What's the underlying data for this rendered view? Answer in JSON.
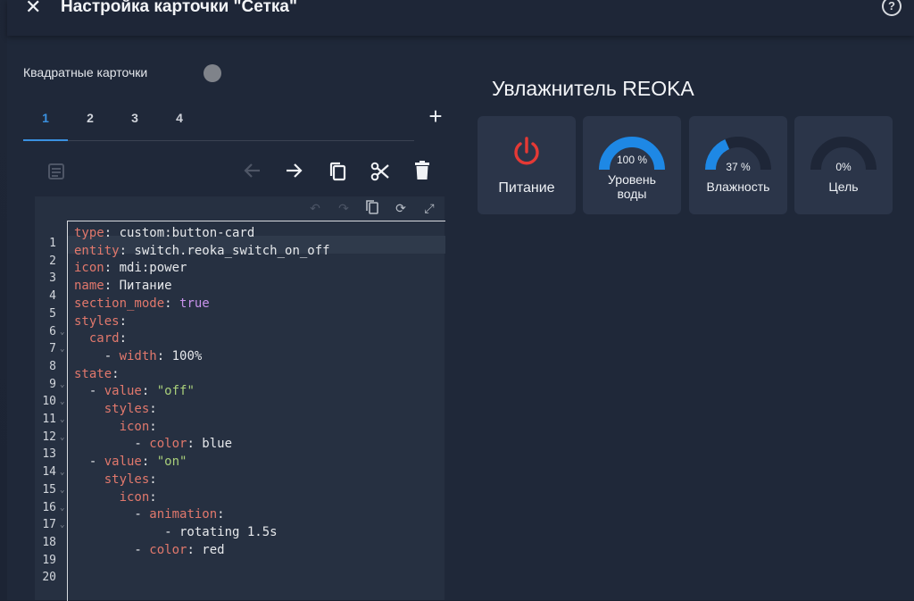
{
  "dialog": {
    "title": "Настройка карточки \"Сетка\"",
    "close_icon": "close-icon",
    "help_icon": "help-circle-icon",
    "help_glyph": "?"
  },
  "editor_options": {
    "square_cards_label": "Квадратные карточки",
    "square_cards_on": false
  },
  "tabs": [
    {
      "label": "1",
      "active": true
    },
    {
      "label": "2",
      "active": false
    },
    {
      "label": "3",
      "active": false
    },
    {
      "label": "4",
      "active": false
    }
  ],
  "toolbar": {
    "icons": [
      "list-editor-icon",
      "arrow-left-icon",
      "arrow-right-icon",
      "copy-icon",
      "cut-icon",
      "delete-icon"
    ]
  },
  "code_editor": {
    "toolbar_icons": [
      "undo-icon",
      "redo-icon",
      "copy-icon",
      "refresh-icon",
      "fullscreen-icon"
    ],
    "lines": [
      {
        "n": "1",
        "fold": false
      },
      {
        "n": "2",
        "fold": false
      },
      {
        "n": "3",
        "fold": false
      },
      {
        "n": "4",
        "fold": false
      },
      {
        "n": "5",
        "fold": false
      },
      {
        "n": "6",
        "fold": true
      },
      {
        "n": "7",
        "fold": true
      },
      {
        "n": "8",
        "fold": false
      },
      {
        "n": "9",
        "fold": true
      },
      {
        "n": "10",
        "fold": true
      },
      {
        "n": "11",
        "fold": true
      },
      {
        "n": "12",
        "fold": true
      },
      {
        "n": "13",
        "fold": false
      },
      {
        "n": "14",
        "fold": true
      },
      {
        "n": "15",
        "fold": true
      },
      {
        "n": "16",
        "fold": true
      },
      {
        "n": "17",
        "fold": true
      },
      {
        "n": "18",
        "fold": false
      },
      {
        "n": "19",
        "fold": false
      },
      {
        "n": "20",
        "fold": false
      }
    ],
    "code": [
      [
        {
          "t": "type",
          "c": "k"
        },
        {
          "t": ": custom:button-card",
          "c": "p"
        }
      ],
      [
        {
          "t": "entity",
          "c": "k"
        },
        {
          "t": ": switch.reoka_switch_on_off",
          "c": "p"
        }
      ],
      [
        {
          "t": "icon",
          "c": "k"
        },
        {
          "t": ": mdi:power",
          "c": "p"
        }
      ],
      [
        {
          "t": "name",
          "c": "k"
        },
        {
          "t": ": Питание",
          "c": "p"
        }
      ],
      [
        {
          "t": "section_mode",
          "c": "k"
        },
        {
          "t": ": ",
          "c": "p"
        },
        {
          "t": "true",
          "c": "b"
        }
      ],
      [
        {
          "t": "styles",
          "c": "k"
        },
        {
          "t": ":",
          "c": "p"
        }
      ],
      [
        {
          "t": "  card",
          "c": "k"
        },
        {
          "t": ":",
          "c": "p"
        }
      ],
      [
        {
          "t": "    - ",
          "c": "p"
        },
        {
          "t": "width",
          "c": "k"
        },
        {
          "t": ": 100%",
          "c": "p"
        }
      ],
      [
        {
          "t": "state",
          "c": "k"
        },
        {
          "t": ":",
          "c": "p"
        }
      ],
      [
        {
          "t": "  - ",
          "c": "p"
        },
        {
          "t": "value",
          "c": "k"
        },
        {
          "t": ": ",
          "c": "p"
        },
        {
          "t": "\"off\"",
          "c": "s"
        }
      ],
      [
        {
          "t": "    styles",
          "c": "k"
        },
        {
          "t": ":",
          "c": "p"
        }
      ],
      [
        {
          "t": "      icon",
          "c": "k"
        },
        {
          "t": ":",
          "c": "p"
        }
      ],
      [
        {
          "t": "        - ",
          "c": "p"
        },
        {
          "t": "color",
          "c": "k"
        },
        {
          "t": ": blue",
          "c": "p"
        }
      ],
      [
        {
          "t": "  - ",
          "c": "p"
        },
        {
          "t": "value",
          "c": "k"
        },
        {
          "t": ": ",
          "c": "p"
        },
        {
          "t": "\"on\"",
          "c": "s"
        }
      ],
      [
        {
          "t": "    styles",
          "c": "k"
        },
        {
          "t": ":",
          "c": "p"
        }
      ],
      [
        {
          "t": "      icon",
          "c": "k"
        },
        {
          "t": ":",
          "c": "p"
        }
      ],
      [
        {
          "t": "        - ",
          "c": "p"
        },
        {
          "t": "animation",
          "c": "k"
        },
        {
          "t": ":",
          "c": "p"
        }
      ],
      [
        {
          "t": "            - rotating 1.5s",
          "c": "p"
        }
      ],
      [
        {
          "t": "        - ",
          "c": "p"
        },
        {
          "t": "color",
          "c": "k"
        },
        {
          "t": ": red",
          "c": "p"
        }
      ],
      []
    ]
  },
  "preview": {
    "title": "Увлажнитель REOKA",
    "tiles": [
      {
        "kind": "button",
        "icon": "power-icon",
        "icon_color": "#e53935",
        "label": "Питание"
      },
      {
        "kind": "gauge",
        "value_text": "100 %",
        "percent": 100,
        "label": "Уровень воды",
        "label_lines": [
          "Уровень",
          "воды"
        ],
        "arc_color": "#1e88e5"
      },
      {
        "kind": "gauge",
        "value_text": "37 %",
        "percent": 37,
        "label": "Влажность",
        "label_lines": [
          "Влажность"
        ],
        "arc_color": "#1e88e5"
      },
      {
        "kind": "gauge",
        "value_text": "0%",
        "percent": 0,
        "label": "Цель",
        "label_lines": [
          "Цель"
        ],
        "arc_color": "#1e88e5"
      }
    ]
  },
  "colors": {
    "accent": "#3a91e0",
    "tile_bg": "#2b3549",
    "gauge_track": "#1e2637"
  }
}
